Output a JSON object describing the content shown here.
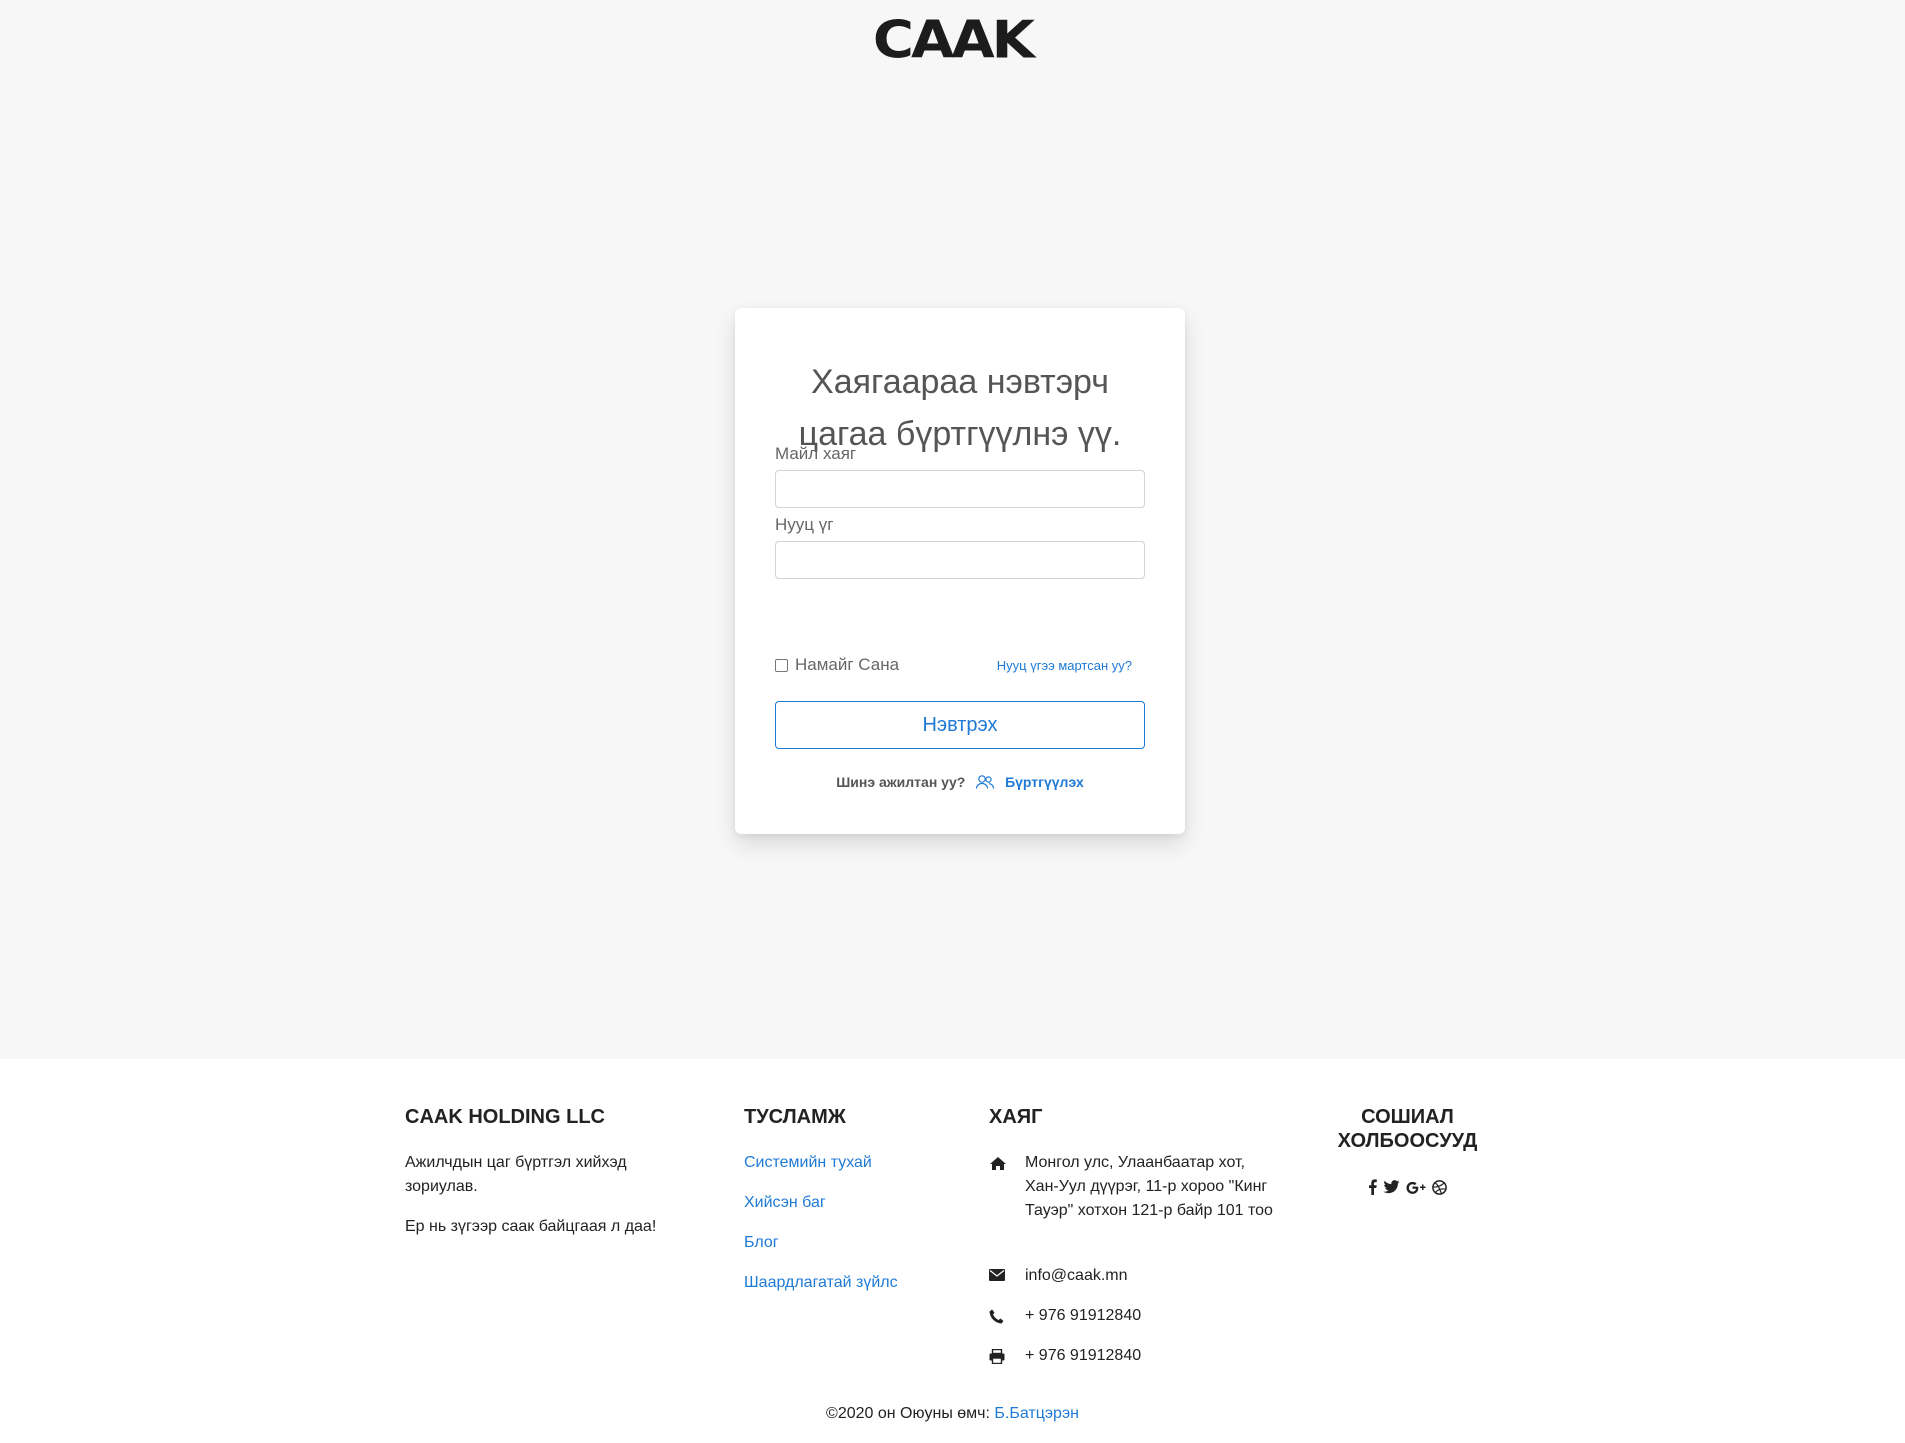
{
  "header": {
    "logo_text": "CAAK"
  },
  "login": {
    "title_line1": "Хаягаараа нэвтэрч",
    "title_line2": "цагаа бүртгүүлнэ үү.",
    "email_label": "Майл хаяг",
    "email_value": "",
    "password_label": "Нууц үг",
    "password_value": "",
    "remember_label": "Намайг Сана",
    "remember_checked": false,
    "forgot_link": "Нууц үгээ мартсан уу?",
    "submit_label": "Нэвтрэх",
    "new_user_text": "Шинэ ажилтан уу?",
    "register_link": "Бүртгүүлэх"
  },
  "footer": {
    "company": {
      "heading": "CAAK HOLDING LLC",
      "line1": "Ажилчдын цаг бүртгэл хийхэд",
      "line2": "зориулав.",
      "line3": "Ер нь зүгээр саак байцгаая л даа!"
    },
    "help": {
      "heading": "ТУСЛАМЖ",
      "links": [
        "Системийн тухай",
        "Хийсэн баг",
        "Блог",
        "Шаардлагатай зүйлс"
      ]
    },
    "address": {
      "heading": "ХАЯГ",
      "line1": "Монгол улс, Улаанбаатар хот,",
      "line2": "Хан-Уул дүүрэг, 11-р хороо \"Кинг",
      "line3": "Тауэр\" хотхон 121-р байр 101 тоо",
      "email": "info@caak.mn",
      "phone": "+ 976 91912840",
      "fax": "+ 976 91912840"
    },
    "social": {
      "heading_line1": "СОШИАЛ",
      "heading_line2": "ХОЛБООСУУД",
      "icons": [
        "facebook-icon",
        "twitter-icon",
        "google-plus-icon",
        "dribbble-icon"
      ]
    },
    "copyright_text": "©2020 он Оюуны өмч: ",
    "copyright_author": "Б.Батцэрэн"
  },
  "colors": {
    "accent": "#1f7ad6",
    "page_bg": "#f7f7f7",
    "footer_bg": "#ffffff"
  }
}
